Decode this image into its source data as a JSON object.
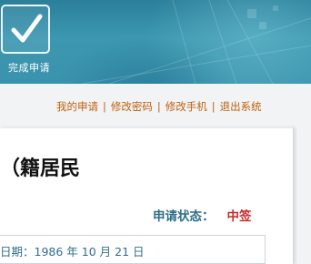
{
  "banner": {
    "done_label": "完成申请"
  },
  "nav": {
    "items": [
      "我的申请",
      "修改密码",
      "修改手机",
      "退出系统"
    ],
    "separator": "|"
  },
  "main": {
    "heading": "籍居民）",
    "status_label": "申请状态：",
    "status_value": "中签",
    "info_partial": "日期：1986 年 10 月 21 日"
  },
  "colors": {
    "banner": "#3a93ad",
    "nav_link": "#c0620f",
    "status_label": "#2e6f86",
    "status_value": "#c62a2a"
  },
  "icons": {
    "done": "check-icon"
  }
}
